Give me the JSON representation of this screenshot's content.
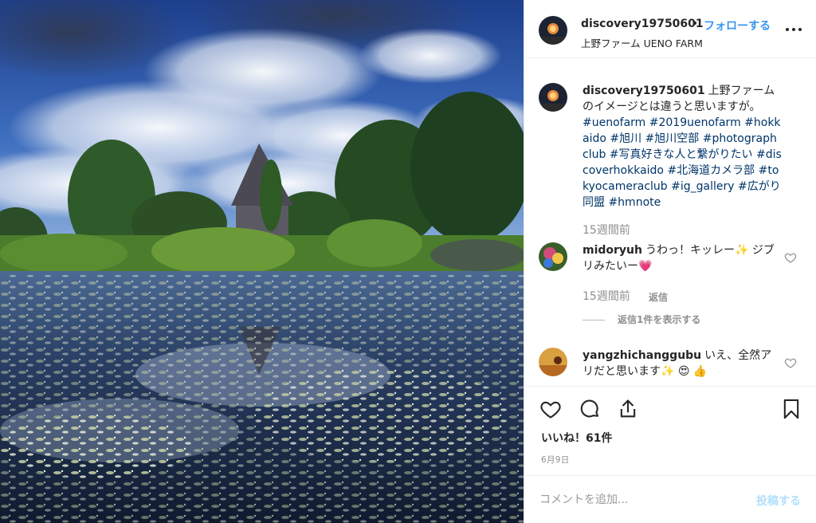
{
  "post": {
    "username": "discovery19750601",
    "separator": "•",
    "follow_label": "フォローする",
    "location": "上野ファーム UENO FARM",
    "more_icon": "more-options-icon"
  },
  "caption": {
    "username": "discovery19750601",
    "text": "上野ファームのイメージとは違うと思いますが。",
    "hashtags": "#uenofarm #2019uenofarm #hokkaido #旭川 #旭川空部 #photographclub #写真好きな人と繋がりたい #discoverhokkaido #北海道カメラ部 #tokyocameraclub #ig_gallery #広がり同盟 #hmnote",
    "time": "15週間前"
  },
  "comments": [
    {
      "username": "midoryuh",
      "text": "うわっ！キッレー✨ ジブリみたいー💗",
      "time": "15週間前",
      "reply_label": "返信",
      "view_replies": "返信1件を表示する"
    },
    {
      "username": "yangzhichanggubu",
      "text": "いえ、全然アリだと思います✨ 😍 👍"
    }
  ],
  "actions": {
    "like_icon": "heart-icon",
    "comment_icon": "comment-icon",
    "share_icon": "share-icon",
    "save_icon": "bookmark-icon",
    "likes_text": "いいね！61件",
    "date": "6月9日"
  },
  "comment_input": {
    "placeholder": "コメントを追加...",
    "post_label": "投稿する"
  },
  "colors": {
    "link_blue": "#3897f0",
    "hashtag": "#003569",
    "muted": "#8e8e8e",
    "post_disabled": "#b2dffc",
    "border": "#efefef"
  }
}
